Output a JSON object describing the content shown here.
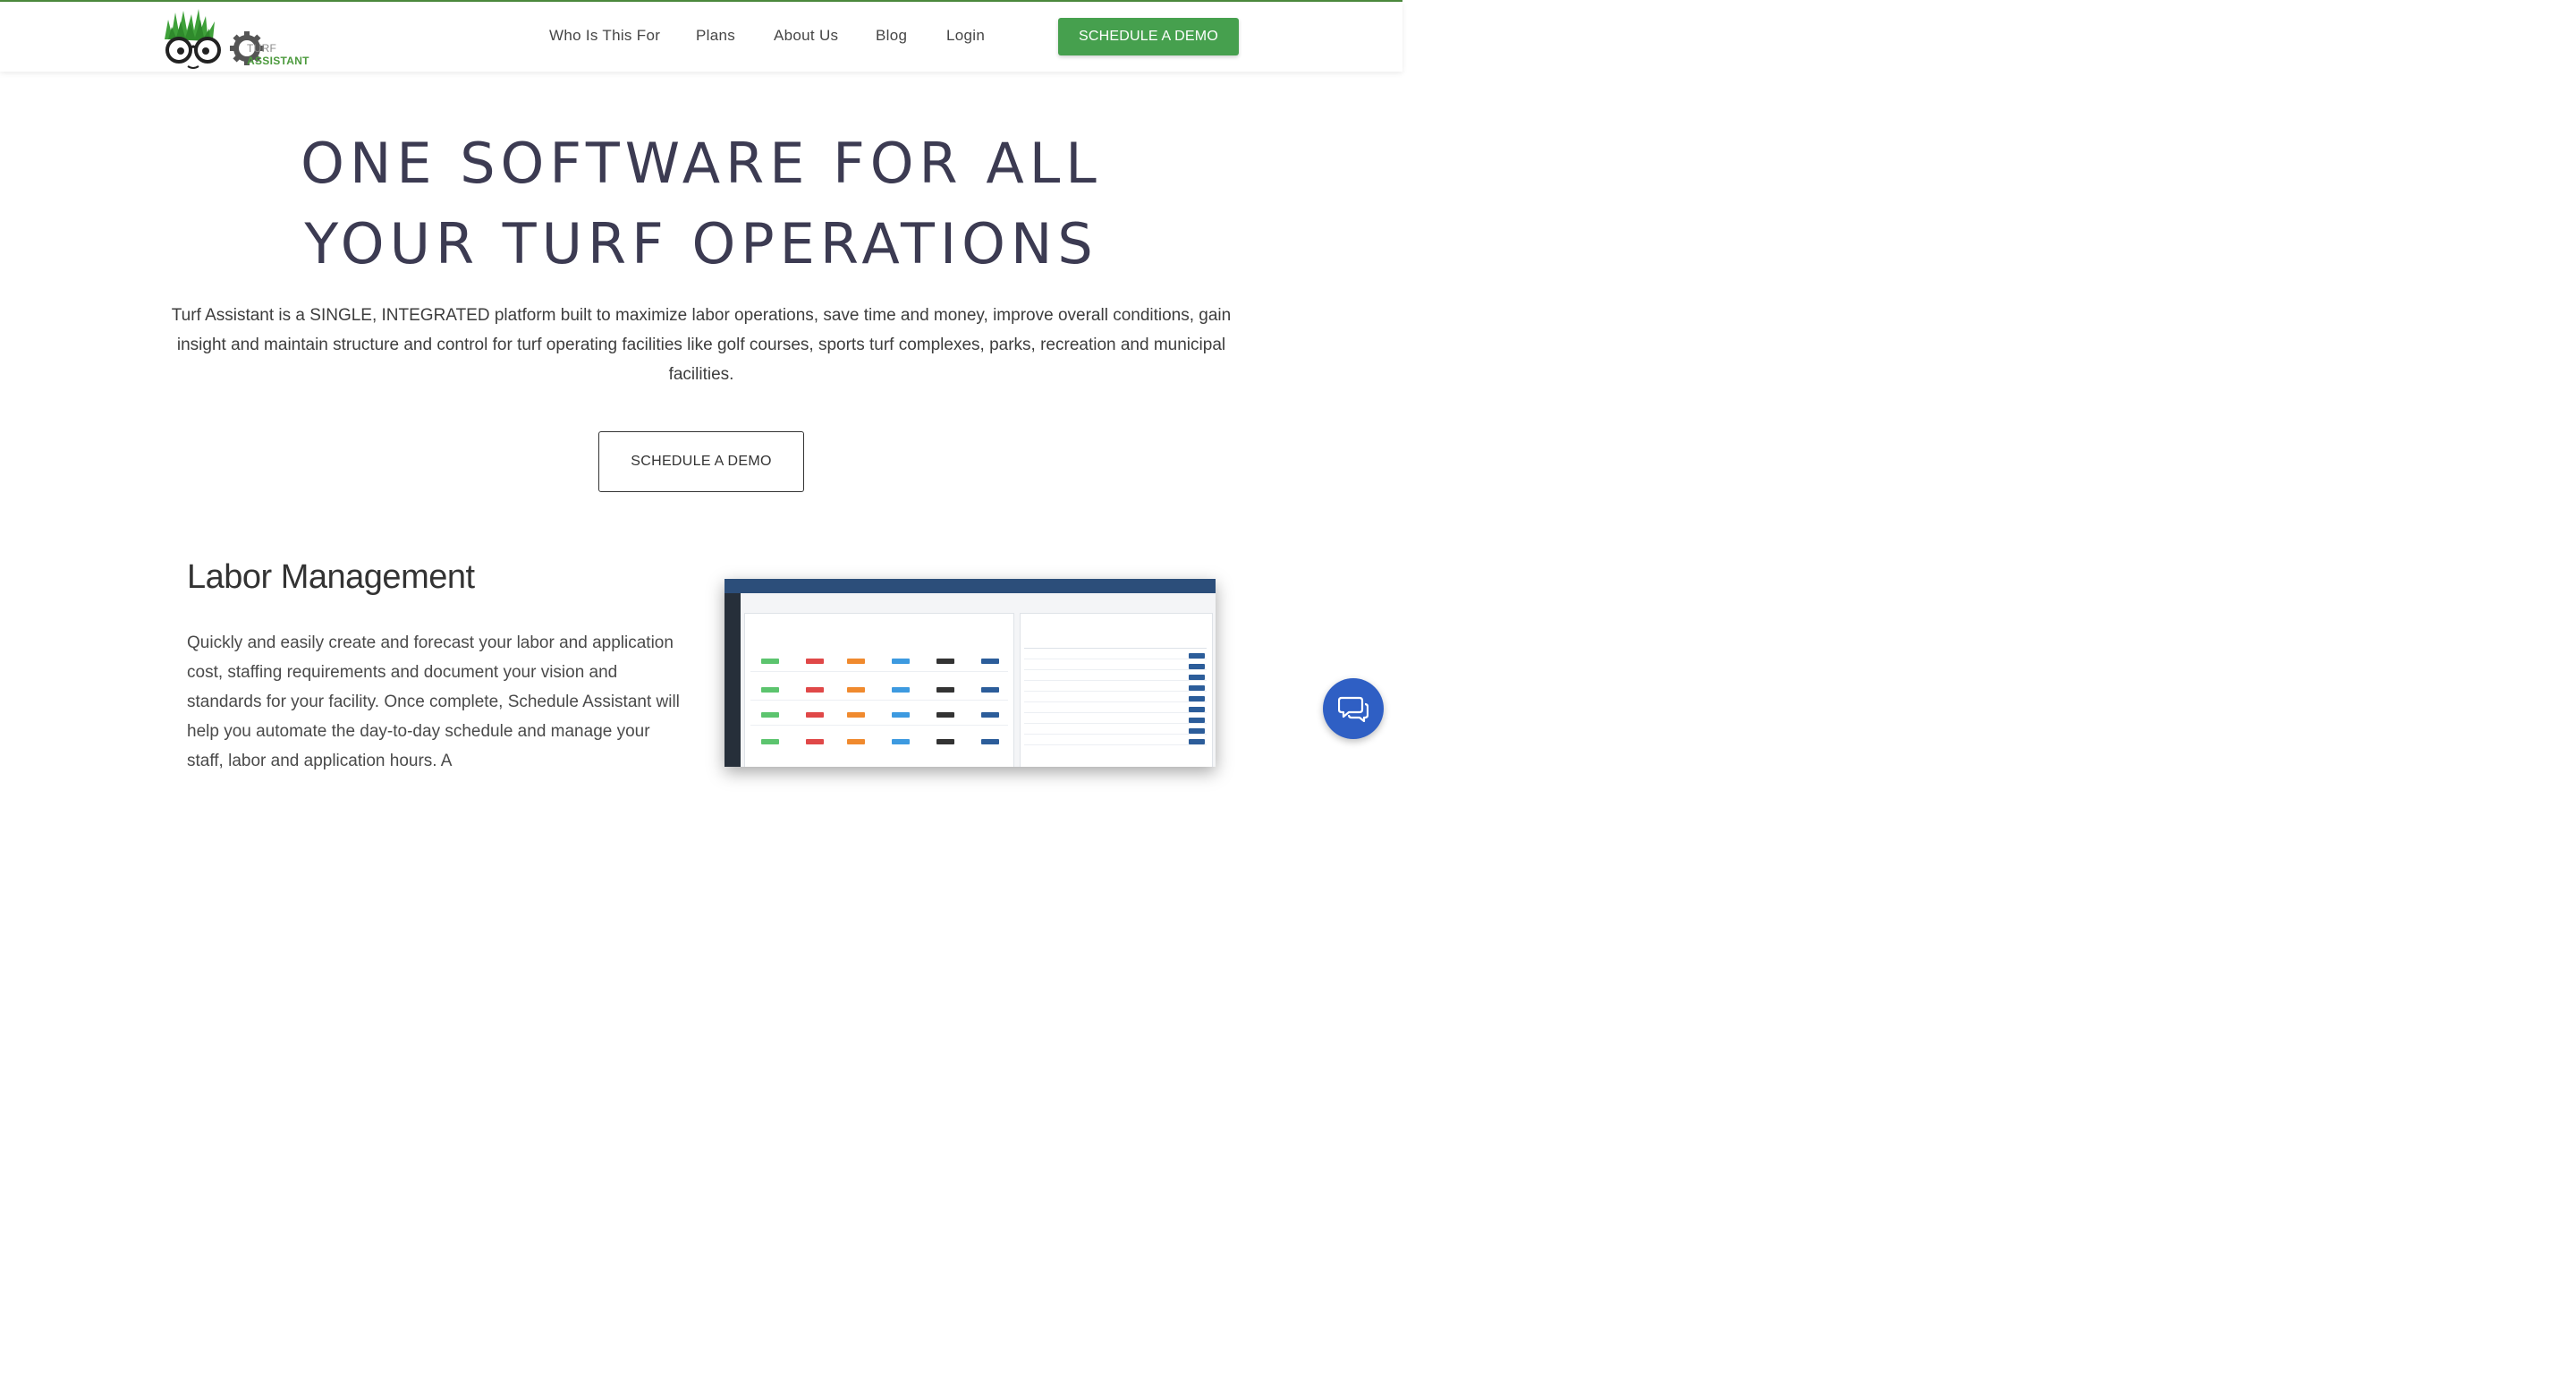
{
  "brand": {
    "logo_text_1": "TURF",
    "logo_text_2": "ASSISTANT",
    "accent_color": "#46a04e"
  },
  "nav": {
    "items": [
      {
        "label": "Who Is This For"
      },
      {
        "label": "Plans"
      },
      {
        "label": "About Us"
      },
      {
        "label": "Blog"
      },
      {
        "label": "Login"
      }
    ],
    "cta": "SCHEDULE A DEMO"
  },
  "hero": {
    "title_line1": "ONE SOFTWARE FOR ALL",
    "title_line2": "YOUR TURF OPERATIONS",
    "description": "Turf Assistant is a SINGLE, INTEGRATED platform built to maximize labor operations, save time and money, improve overall conditions, gain insight and maintain structure and control for turf operating facilities like golf courses, sports turf complexes, parks, recreation and municipal facilities.",
    "cta": "SCHEDULE A DEMO"
  },
  "labor": {
    "title": "Labor Management",
    "text": "Quickly and easily create and forecast your labor and application cost, staffing requirements and document your vision and standards for your facility. Once complete, Schedule Assistant will help you automate the day-to-day schedule and manage your staff, labor and application hours. A"
  },
  "icons": {
    "chat": "chat-bubbles-icon",
    "gear": "gear-icon",
    "logo": "turf-mascot-logo"
  }
}
